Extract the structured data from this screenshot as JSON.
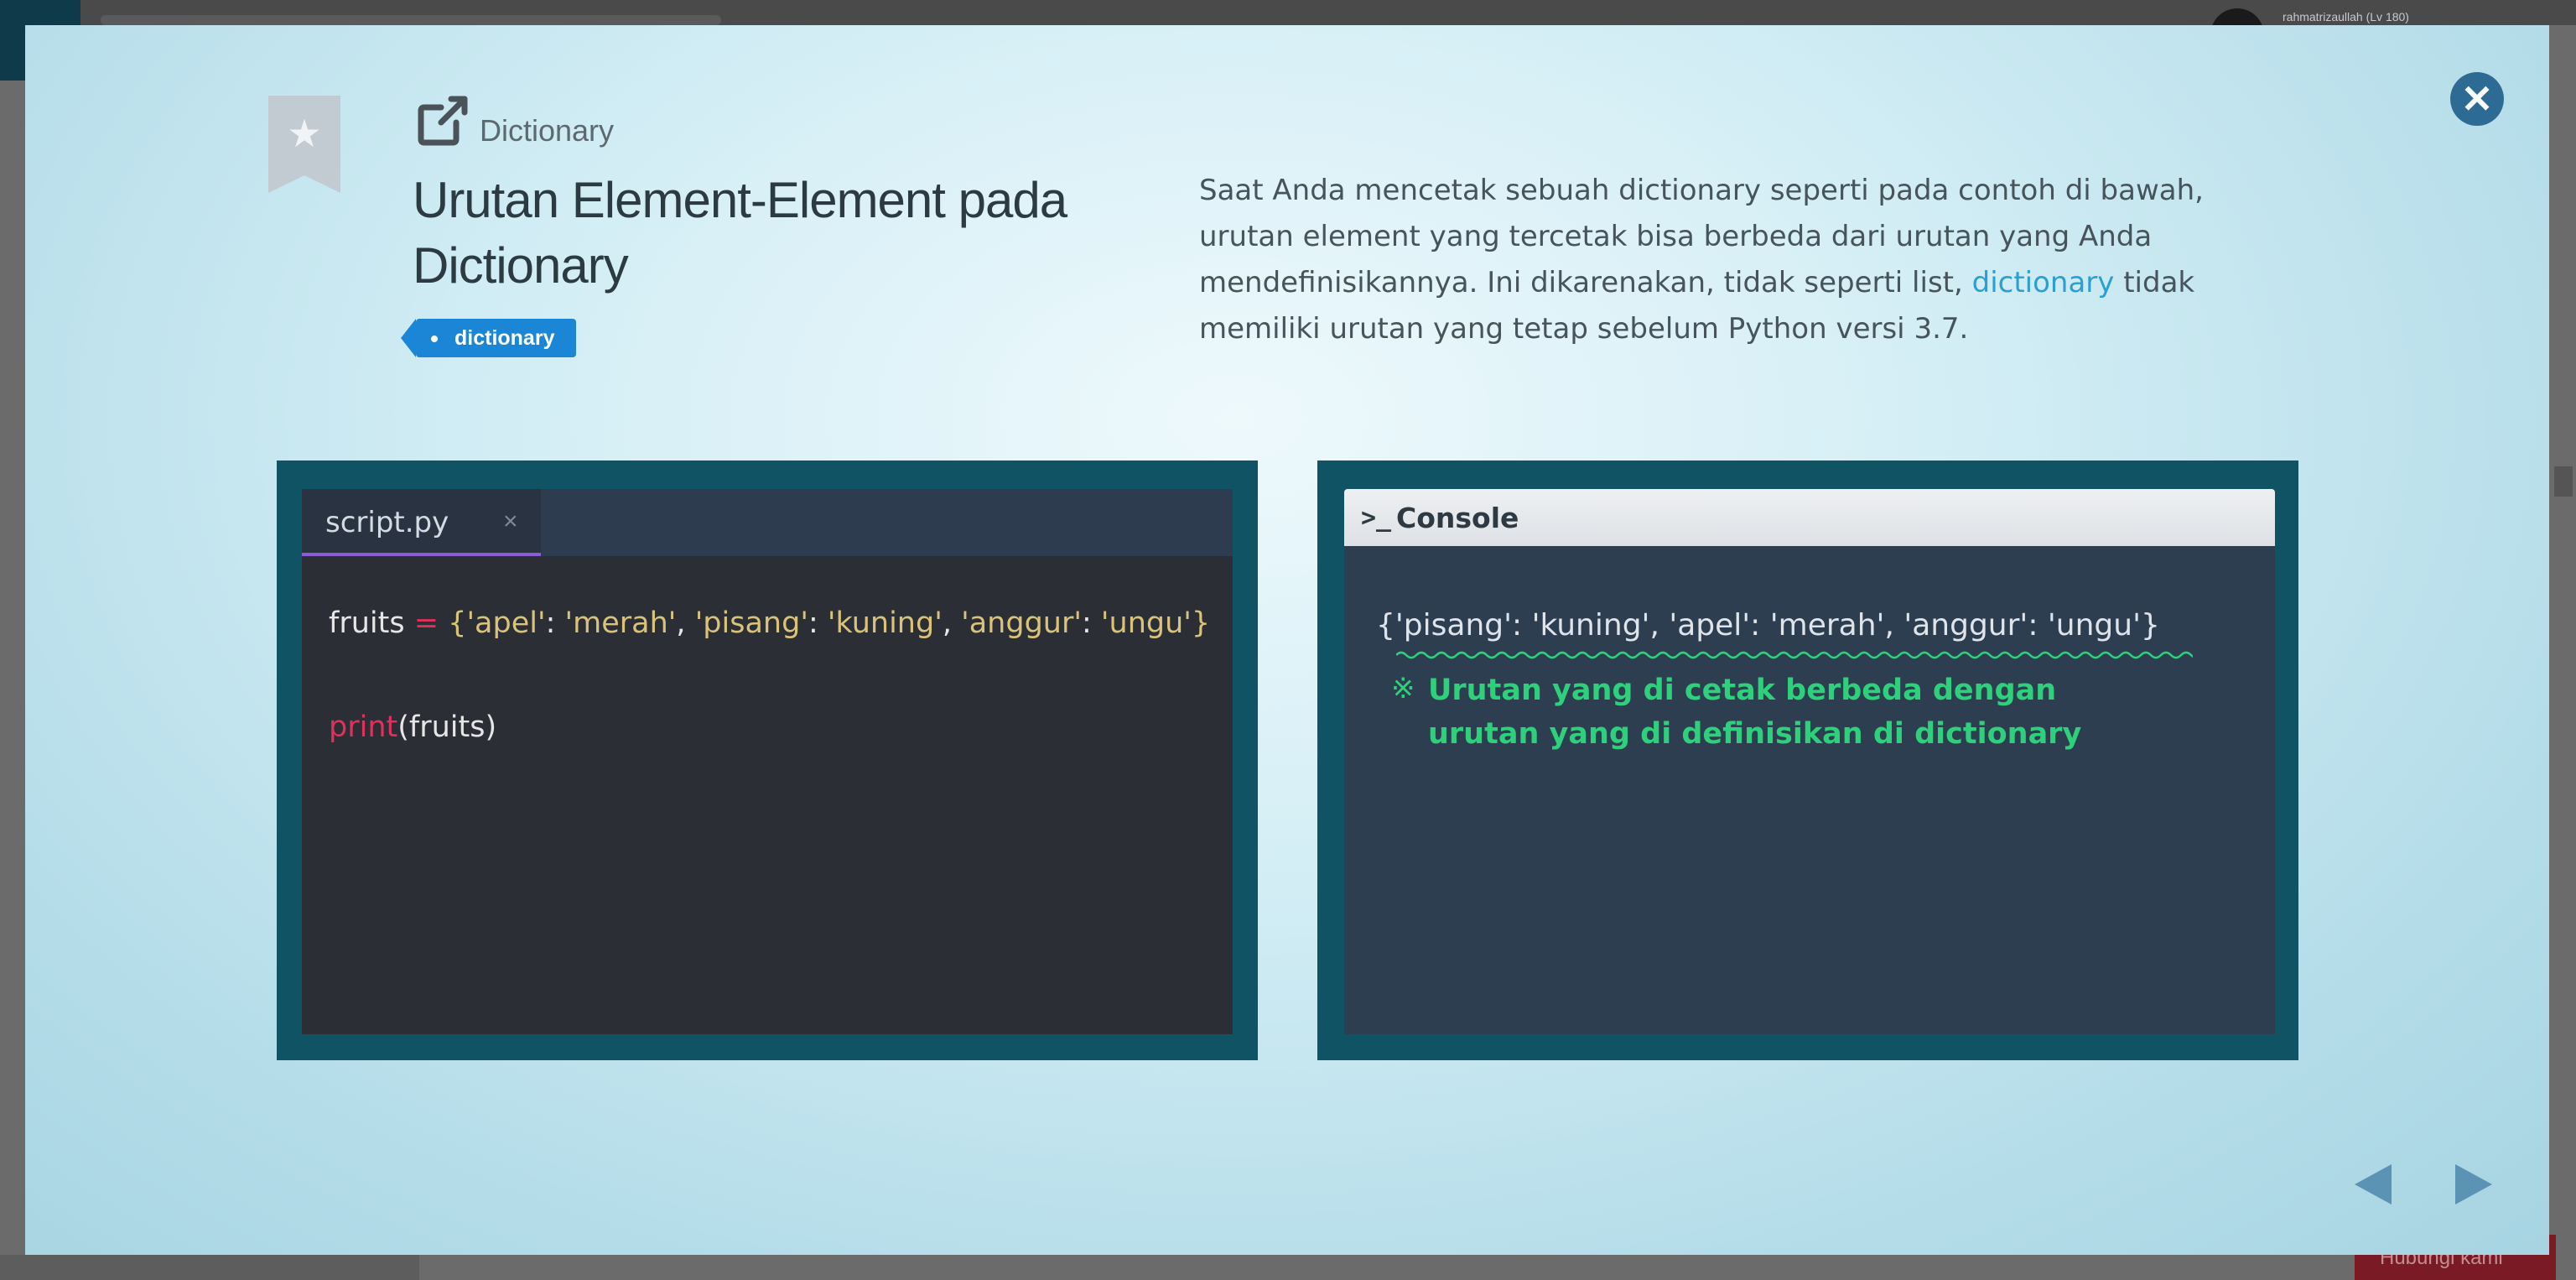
{
  "background": {
    "user_label": "rahmatrizaullah (Lv 180)",
    "bottom_button": "Hubungi kami"
  },
  "header": {
    "section": "Dictionary",
    "title_line1": "Urutan Element-Element pada",
    "title_line2": "Dictionary",
    "tag": "dictionary"
  },
  "description": {
    "part1": "Saat Anda mencetak sebuah dictionary seperti pada contoh di bawah, urutan element yang tercetak bisa berbeda dari urutan yang Anda mendefinisikannya. Ini dikarenakan, tidak seperti list, ",
    "link": "dictionary",
    "part2": " tidak memiliki urutan yang tetap sebelum Python versi 3.7."
  },
  "editor": {
    "tab_label": "script.py",
    "tab_close": "×",
    "line1": {
      "var": "fruits ",
      "op": "=",
      "open": " {",
      "k1": "'apel'",
      "sep1": ": ",
      "v1": "'merah'",
      "c1": ", ",
      "k2": "'pisang'",
      "sep2": ": ",
      "v2": "'kuning'",
      "c2": ", ",
      "k3": "'anggur'",
      "sep3": ": ",
      "v3": "'ungu'",
      "close": "}"
    },
    "line2": {
      "fn": "print",
      "args": "(fruits)"
    }
  },
  "console": {
    "icon": ">_",
    "title": "Console",
    "output": "{'pisang': 'kuning', 'apel': 'merah', 'anggur': 'ungu'}",
    "note_mark": "※",
    "note_line1": "Urutan yang di cetak berbeda dengan",
    "note_line2": "urutan yang di definisikan di dictionary"
  },
  "colors": {
    "accent": "#1b86d6",
    "panel": "#0f5364",
    "note": "#2fd07c",
    "keyword": "#e0315c",
    "string": "#d9c27a"
  },
  "icons": {
    "bookmark": "star-bookmark-icon",
    "external": "external-link-icon",
    "close": "close-icon",
    "prev": "triangle-left-icon",
    "next": "triangle-right-icon"
  }
}
